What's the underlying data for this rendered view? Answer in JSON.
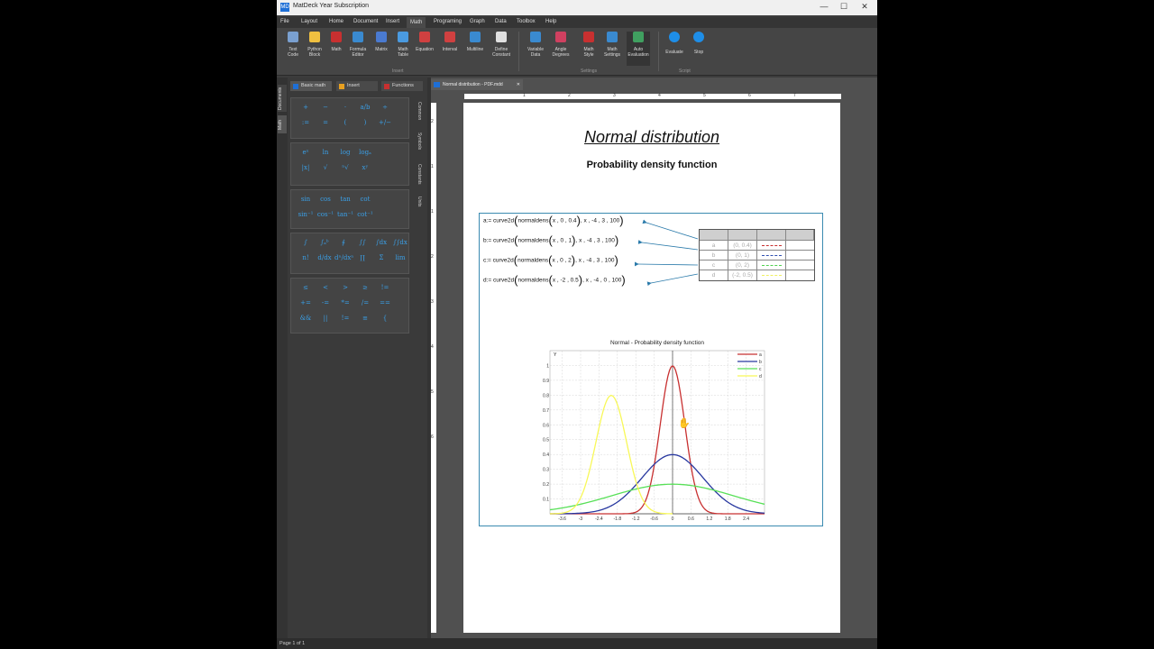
{
  "window": {
    "title": "MatDeck Year Subscription",
    "logo": "MD",
    "controls": [
      "—",
      "☐",
      "✕"
    ]
  },
  "menu": [
    "File",
    "Layout",
    "Home",
    "Document",
    "Insert",
    "Math",
    "Programing",
    "Graph",
    "Data",
    "Toolbox",
    "Help"
  ],
  "active_menu": "Math",
  "ribbon": {
    "insert_buttons": [
      {
        "label": "Text\nCode",
        "icon": "text-code-icon"
      },
      {
        "label": "Python\nBlock",
        "icon": "python-icon"
      },
      {
        "label": "Math",
        "icon": "math-icon"
      },
      {
        "label": "Formula\nEditor",
        "icon": "formula-icon"
      },
      {
        "label": "Matrix",
        "icon": "matrix-icon"
      },
      {
        "label": "Math\nTable",
        "icon": "table-icon"
      },
      {
        "label": "Equation",
        "icon": "equation-icon"
      },
      {
        "label": "Interval",
        "icon": "interval-icon"
      },
      {
        "label": "Multiline",
        "icon": "multiline-icon"
      },
      {
        "label": "Define\nConstant",
        "icon": "pi-icon"
      }
    ],
    "insert_group": "Insert",
    "settings_buttons": [
      {
        "label": "Variable\nData",
        "icon": "variable-data-icon"
      },
      {
        "label": "Angle\nDegrees",
        "icon": "angle-icon"
      },
      {
        "label": "Math\nStyle",
        "icon": "math-style-icon"
      },
      {
        "label": "Math\nSettings",
        "icon": "settings-icon"
      },
      {
        "label": "Auto\nEvaluation",
        "icon": "auto-eval-icon"
      }
    ],
    "settings_group": "Settings",
    "script_buttons": [
      {
        "label": "Evaluate",
        "icon": "play-icon"
      },
      {
        "label": "Stop",
        "icon": "stop-icon"
      }
    ],
    "script_group": "Script"
  },
  "left_panel": {
    "side_tabs": [
      "Documents",
      "Math"
    ],
    "top_tabs": [
      "Basic math",
      "Insert",
      "Functions"
    ],
    "right_tabs": [
      "Common",
      "Symbols",
      "Constants",
      "Units"
    ],
    "palettes": [
      [
        "+",
        "−",
        "·",
        "a/b",
        "÷",
        ":=",
        "=",
        "(",
        ")",
        "+/−"
      ],
      [
        "eˣ",
        "ln",
        "log",
        "logₐ",
        "|x|",
        "√",
        "ⁿ√",
        "xʸ"
      ],
      [
        "sin",
        "cos",
        "tan",
        "cot",
        "sin⁻¹",
        "cos⁻¹",
        "tan⁻¹",
        "cot⁻¹"
      ],
      [
        "∫",
        "∫ₐᵇ",
        "∮",
        "∫∫",
        "∫dx",
        "∫∫dx",
        "n!",
        "d/dx",
        "dⁿ/dxⁿ",
        "∏",
        "Σ",
        "lim"
      ],
      [
        "≤",
        "<",
        ">",
        "≥",
        "!=",
        "+=",
        "-=",
        "*=",
        "/=",
        "==",
        "&&",
        "||",
        "!=",
        "≡",
        "{"
      ]
    ]
  },
  "doc_tab": {
    "label": "Normal distribution - PDF.mdd",
    "close": "✕"
  },
  "ruler": {
    "h": [
      "1",
      "2",
      "3",
      "4",
      "5",
      "6",
      "7"
    ],
    "v": [
      "2",
      "1",
      "1",
      "2",
      "3",
      "4",
      "5",
      "6"
    ]
  },
  "document": {
    "title": "Normal distribution",
    "subtitle": "Probability density function",
    "formulas": [
      {
        "lhs": "a:= curve2d",
        "fn": "normaldens",
        "args": "x , 0 , 0.4",
        "rest": ", x , -4 , 3 , 100"
      },
      {
        "lhs": "b:= curve2d",
        "fn": "normaldens",
        "args": "x , 0 , 1",
        "rest": ", x , -4 , 3 , 100"
      },
      {
        "lhs": "c:= curve2d",
        "fn": "normaldens",
        "args": "x , 0 , 2",
        "rest": ", x , -4 , 3 , 100"
      },
      {
        "lhs": "d:= curve2d",
        "fn": "normaldens",
        "args": "x , -2 , 0.5",
        "rest": ", x , -4 , 0 , 100"
      }
    ],
    "curve_table": [
      {
        "name": "a",
        "params": "(0, 0.4)",
        "color": "#c83030"
      },
      {
        "name": "b",
        "params": "(0, 1)",
        "color": "#3050b0"
      },
      {
        "name": "c",
        "params": "(0, 2)",
        "color": "#50d050"
      },
      {
        "name": "d",
        "params": "(-2, 0.5)",
        "color": "#f0f060"
      }
    ]
  },
  "chart_data": {
    "type": "line",
    "title": "Normal - Probability density function",
    "ylabel": "Y",
    "xlim": [
      -4,
      3
    ],
    "ylim": [
      0,
      1.1
    ],
    "xticks": [
      -3.6,
      -3,
      -2.4,
      -1.8,
      -1.2,
      -0.6,
      0,
      0.6,
      1.2,
      1.8,
      2.4
    ],
    "yticks": [
      0.1,
      0.2,
      0.3,
      0.4,
      0.5,
      0.6,
      0.7,
      0.8,
      0.9,
      1
    ],
    "grid": true,
    "legend": "top-right",
    "series": [
      {
        "name": "a",
        "mean": 0,
        "sd": 0.4,
        "x_range": [
          -4,
          3
        ],
        "color": "#c83030"
      },
      {
        "name": "b",
        "mean": 0,
        "sd": 1,
        "x_range": [
          -4,
          3
        ],
        "color": "#2838a0"
      },
      {
        "name": "c",
        "mean": 0,
        "sd": 2,
        "x_range": [
          -4,
          3
        ],
        "color": "#58e058"
      },
      {
        "name": "d",
        "mean": -2,
        "sd": 0.5,
        "x_range": [
          -4,
          0
        ],
        "color": "#f8f858"
      }
    ]
  },
  "status": "Page 1 of 1"
}
